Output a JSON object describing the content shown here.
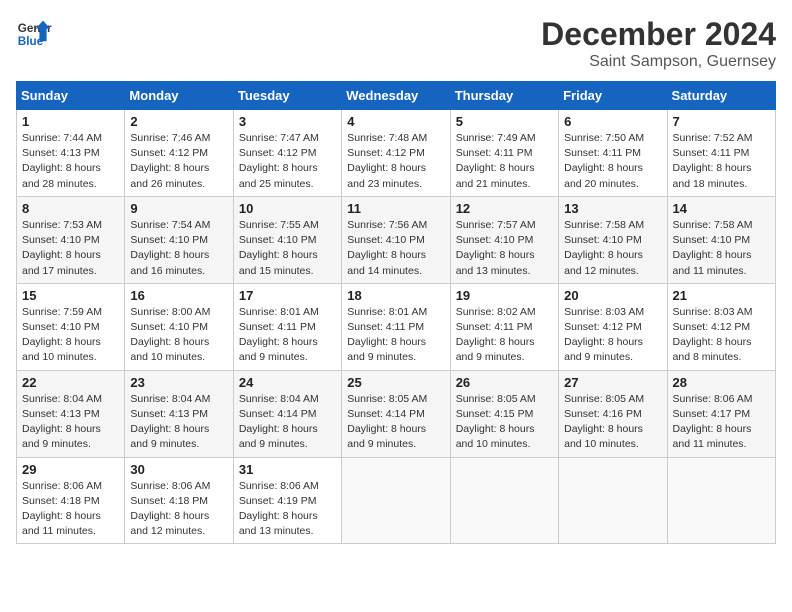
{
  "header": {
    "logo_line1": "General",
    "logo_line2": "Blue",
    "main_title": "December 2024",
    "sub_title": "Saint Sampson, Guernsey"
  },
  "days_of_week": [
    "Sunday",
    "Monday",
    "Tuesday",
    "Wednesday",
    "Thursday",
    "Friday",
    "Saturday"
  ],
  "weeks": [
    [
      {
        "day": "1",
        "sunrise": "7:44 AM",
        "sunset": "4:13 PM",
        "daylight": "8 hours and 28 minutes."
      },
      {
        "day": "2",
        "sunrise": "7:46 AM",
        "sunset": "4:12 PM",
        "daylight": "8 hours and 26 minutes."
      },
      {
        "day": "3",
        "sunrise": "7:47 AM",
        "sunset": "4:12 PM",
        "daylight": "8 hours and 25 minutes."
      },
      {
        "day": "4",
        "sunrise": "7:48 AM",
        "sunset": "4:12 PM",
        "daylight": "8 hours and 23 minutes."
      },
      {
        "day": "5",
        "sunrise": "7:49 AM",
        "sunset": "4:11 PM",
        "daylight": "8 hours and 21 minutes."
      },
      {
        "day": "6",
        "sunrise": "7:50 AM",
        "sunset": "4:11 PM",
        "daylight": "8 hours and 20 minutes."
      },
      {
        "day": "7",
        "sunrise": "7:52 AM",
        "sunset": "4:11 PM",
        "daylight": "8 hours and 18 minutes."
      }
    ],
    [
      {
        "day": "8",
        "sunrise": "7:53 AM",
        "sunset": "4:10 PM",
        "daylight": "8 hours and 17 minutes."
      },
      {
        "day": "9",
        "sunrise": "7:54 AM",
        "sunset": "4:10 PM",
        "daylight": "8 hours and 16 minutes."
      },
      {
        "day": "10",
        "sunrise": "7:55 AM",
        "sunset": "4:10 PM",
        "daylight": "8 hours and 15 minutes."
      },
      {
        "day": "11",
        "sunrise": "7:56 AM",
        "sunset": "4:10 PM",
        "daylight": "8 hours and 14 minutes."
      },
      {
        "day": "12",
        "sunrise": "7:57 AM",
        "sunset": "4:10 PM",
        "daylight": "8 hours and 13 minutes."
      },
      {
        "day": "13",
        "sunrise": "7:58 AM",
        "sunset": "4:10 PM",
        "daylight": "8 hours and 12 minutes."
      },
      {
        "day": "14",
        "sunrise": "7:58 AM",
        "sunset": "4:10 PM",
        "daylight": "8 hours and 11 minutes."
      }
    ],
    [
      {
        "day": "15",
        "sunrise": "7:59 AM",
        "sunset": "4:10 PM",
        "daylight": "8 hours and 10 minutes."
      },
      {
        "day": "16",
        "sunrise": "8:00 AM",
        "sunset": "4:10 PM",
        "daylight": "8 hours and 10 minutes."
      },
      {
        "day": "17",
        "sunrise": "8:01 AM",
        "sunset": "4:11 PM",
        "daylight": "8 hours and 9 minutes."
      },
      {
        "day": "18",
        "sunrise": "8:01 AM",
        "sunset": "4:11 PM",
        "daylight": "8 hours and 9 minutes."
      },
      {
        "day": "19",
        "sunrise": "8:02 AM",
        "sunset": "4:11 PM",
        "daylight": "8 hours and 9 minutes."
      },
      {
        "day": "20",
        "sunrise": "8:03 AM",
        "sunset": "4:12 PM",
        "daylight": "8 hours and 9 minutes."
      },
      {
        "day": "21",
        "sunrise": "8:03 AM",
        "sunset": "4:12 PM",
        "daylight": "8 hours and 8 minutes."
      }
    ],
    [
      {
        "day": "22",
        "sunrise": "8:04 AM",
        "sunset": "4:13 PM",
        "daylight": "8 hours and 9 minutes."
      },
      {
        "day": "23",
        "sunrise": "8:04 AM",
        "sunset": "4:13 PM",
        "daylight": "8 hours and 9 minutes."
      },
      {
        "day": "24",
        "sunrise": "8:04 AM",
        "sunset": "4:14 PM",
        "daylight": "8 hours and 9 minutes."
      },
      {
        "day": "25",
        "sunrise": "8:05 AM",
        "sunset": "4:14 PM",
        "daylight": "8 hours and 9 minutes."
      },
      {
        "day": "26",
        "sunrise": "8:05 AM",
        "sunset": "4:15 PM",
        "daylight": "8 hours and 10 minutes."
      },
      {
        "day": "27",
        "sunrise": "8:05 AM",
        "sunset": "4:16 PM",
        "daylight": "8 hours and 10 minutes."
      },
      {
        "day": "28",
        "sunrise": "8:06 AM",
        "sunset": "4:17 PM",
        "daylight": "8 hours and 11 minutes."
      }
    ],
    [
      {
        "day": "29",
        "sunrise": "8:06 AM",
        "sunset": "4:18 PM",
        "daylight": "8 hours and 11 minutes."
      },
      {
        "day": "30",
        "sunrise": "8:06 AM",
        "sunset": "4:18 PM",
        "daylight": "8 hours and 12 minutes."
      },
      {
        "day": "31",
        "sunrise": "8:06 AM",
        "sunset": "4:19 PM",
        "daylight": "8 hours and 13 minutes."
      },
      null,
      null,
      null,
      null
    ]
  ]
}
